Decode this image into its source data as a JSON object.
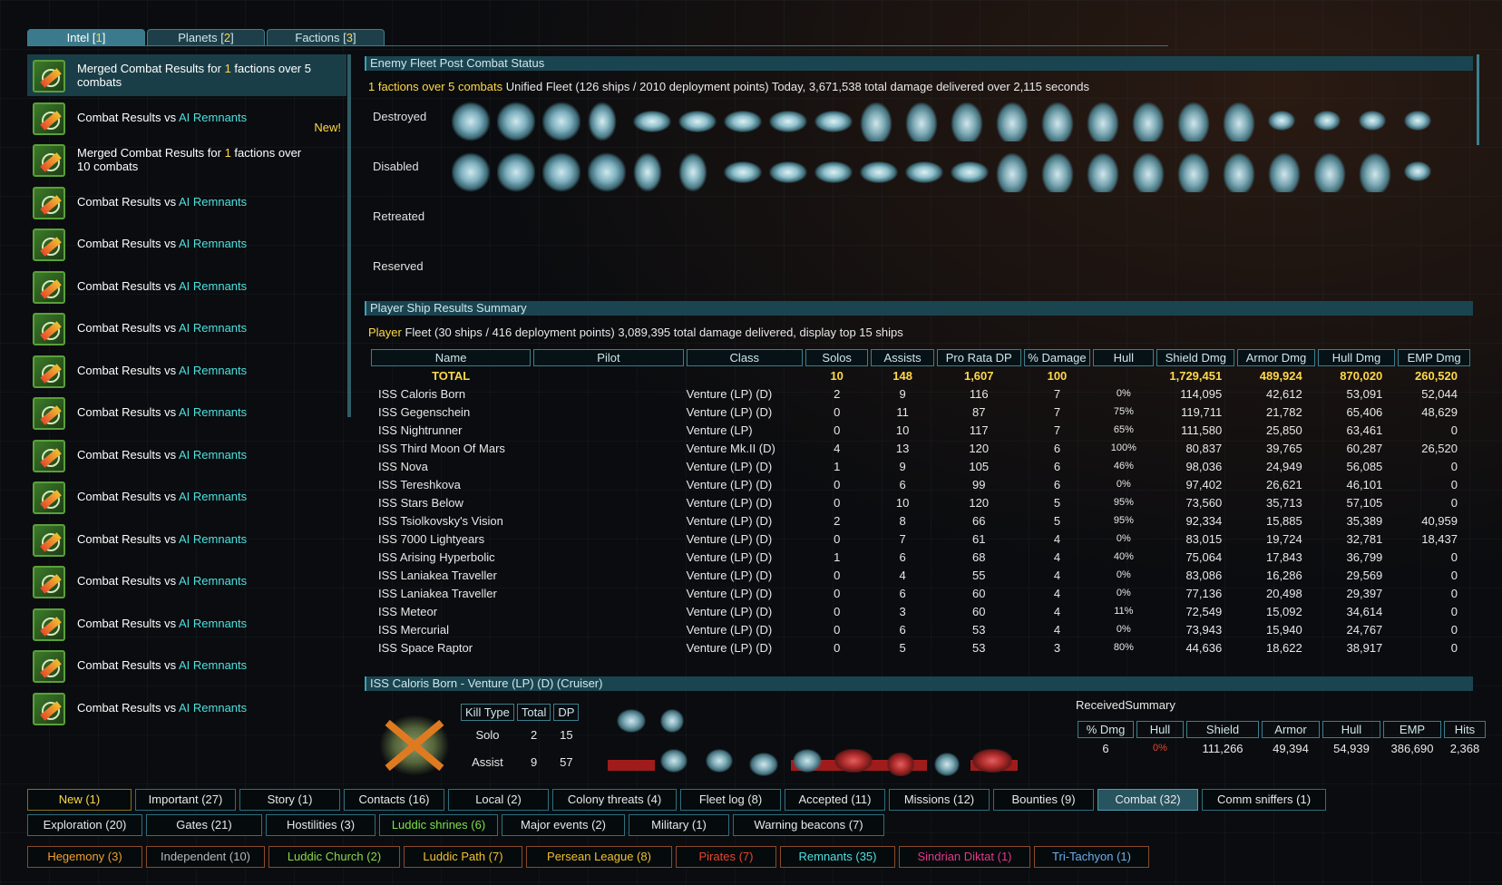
{
  "top_tabs": [
    {
      "label": "Intel",
      "count": "1"
    },
    {
      "label": "Planets",
      "count": "2"
    },
    {
      "label": "Factions",
      "count": "3"
    }
  ],
  "intel_list": {
    "items": [
      {
        "pre": "Merged Combat Results for ",
        "hl": "1",
        "post": " factions over 5 combats",
        "selected": true
      },
      {
        "pre": "Combat Results vs ",
        "hl": "AI Remnants",
        "new": "New!"
      },
      {
        "pre": "Merged Combat Results for ",
        "hl": "1",
        "post": " factions over 10 combats"
      },
      {
        "pre": "Combat Results vs ",
        "hl": "AI Remnants"
      },
      {
        "pre": "Combat Results vs ",
        "hl": "AI Remnants"
      },
      {
        "pre": "Combat Results vs ",
        "hl": "AI Remnants"
      },
      {
        "pre": "Combat Results vs ",
        "hl": "AI Remnants"
      },
      {
        "pre": "Combat Results vs ",
        "hl": "AI Remnants"
      },
      {
        "pre": "Combat Results vs ",
        "hl": "AI Remnants"
      },
      {
        "pre": "Combat Results vs ",
        "hl": "AI Remnants"
      },
      {
        "pre": "Combat Results vs ",
        "hl": "AI Remnants"
      },
      {
        "pre": "Combat Results vs ",
        "hl": "AI Remnants"
      },
      {
        "pre": "Combat Results vs ",
        "hl": "AI Remnants"
      },
      {
        "pre": "Combat Results vs ",
        "hl": "AI Remnants"
      },
      {
        "pre": "Combat Results vs ",
        "hl": "AI Remnants"
      },
      {
        "pre": "Combat Results vs ",
        "hl": "AI Remnants"
      }
    ]
  },
  "enemy": {
    "title": "Enemy Fleet Post Combat Status",
    "summary_hl": "1 factions over 5 combats",
    "summary_rest": " Unified Fleet (126 ships / 2010 deployment points) Today, 3,671,538 total damage delivered over 2,115 seconds",
    "rows": {
      "destroyed": "Destroyed",
      "disabled": "Disabled",
      "retreated": "Retreated",
      "reserved": "Reserved"
    }
  },
  "player": {
    "title": "Player Ship Results Summary",
    "summary_hl": "Player",
    "summary_rest": " Fleet (30 ships / 416 deployment points) 3,089,395 total damage delivered, display top 15 ships",
    "headers": [
      "Name",
      "Pilot",
      "Class",
      "Solos",
      "Assists",
      "Pro Rata DP",
      "% Damage",
      "Hull",
      "Shield Dmg",
      "Armor Dmg",
      "Hull Dmg",
      "EMP Dmg"
    ],
    "total": {
      "name": "TOTAL",
      "solos": "10",
      "assists": "148",
      "dp": "1,607",
      "dmg": "100",
      "shield": "1,729,451",
      "armor": "489,924",
      "hull_dmg": "870,020",
      "emp": "260,520"
    },
    "ships": [
      {
        "name": "ISS Caloris Born",
        "class": "Venture (LP) (D)",
        "solos": "2",
        "assists": "9",
        "dp": "116",
        "dmg": "7",
        "hull": "0%",
        "hc": "red",
        "shield": "114,095",
        "armor": "42,612",
        "hull_dmg": "53,091",
        "emp": "52,044"
      },
      {
        "name": "ISS Gegenschein",
        "class": "Venture (LP) (D)",
        "solos": "0",
        "assists": "11",
        "dp": "87",
        "dmg": "7",
        "hull": "75%",
        "hc": "yellow",
        "shield": "119,711",
        "armor": "21,782",
        "hull_dmg": "65,406",
        "emp": "48,629"
      },
      {
        "name": "ISS Nightrunner",
        "class": "Venture (LP)",
        "solos": "0",
        "assists": "10",
        "dp": "117",
        "dmg": "7",
        "hull": "65%",
        "hc": "yellow",
        "shield": "111,580",
        "armor": "25,850",
        "hull_dmg": "63,461",
        "emp": "0"
      },
      {
        "name": "ISS Third Moon Of Mars",
        "class": "Venture Mk.II (D)",
        "solos": "4",
        "assists": "13",
        "dp": "120",
        "dmg": "6",
        "hull": "100%",
        "hc": "white",
        "shield": "80,837",
        "armor": "39,765",
        "hull_dmg": "60,287",
        "emp": "26,520"
      },
      {
        "name": "ISS Nova",
        "class": "Venture (LP) (D)",
        "solos": "1",
        "assists": "9",
        "dp": "105",
        "dmg": "6",
        "hull": "46%",
        "hc": "orange",
        "shield": "98,036",
        "armor": "24,949",
        "hull_dmg": "56,085",
        "emp": "0"
      },
      {
        "name": "ISS Tereshkova",
        "class": "Venture (LP) (D)",
        "solos": "0",
        "assists": "6",
        "dp": "99",
        "dmg": "6",
        "hull": "0%",
        "hc": "red",
        "shield": "97,402",
        "armor": "26,621",
        "hull_dmg": "46,101",
        "emp": "0"
      },
      {
        "name": "ISS Stars Below",
        "class": "Venture (LP) (D)",
        "solos": "0",
        "assists": "10",
        "dp": "120",
        "dmg": "5",
        "hull": "95%",
        "hc": "yellow",
        "shield": "73,560",
        "armor": "35,713",
        "hull_dmg": "57,105",
        "emp": "0"
      },
      {
        "name": "ISS Tsiolkovsky's Vision",
        "class": "Venture (LP) (D)",
        "solos": "2",
        "assists": "8",
        "dp": "66",
        "dmg": "5",
        "hull": "95%",
        "hc": "yellow",
        "shield": "92,334",
        "armor": "15,885",
        "hull_dmg": "35,389",
        "emp": "40,959"
      },
      {
        "name": "ISS 7000 Lightyears",
        "class": "Venture (LP) (D)",
        "solos": "0",
        "assists": "7",
        "dp": "61",
        "dmg": "4",
        "hull": "0%",
        "hc": "red",
        "shield": "83,015",
        "armor": "19,724",
        "hull_dmg": "32,781",
        "emp": "18,437"
      },
      {
        "name": "ISS Arising Hyperbolic",
        "class": "Venture (LP) (D)",
        "solos": "1",
        "assists": "6",
        "dp": "68",
        "dmg": "4",
        "hull": "40%",
        "hc": "orange",
        "shield": "75,064",
        "armor": "17,843",
        "hull_dmg": "36,799",
        "emp": "0"
      },
      {
        "name": "ISS Laniakea Traveller",
        "class": "Venture (LP) (D)",
        "solos": "0",
        "assists": "4",
        "dp": "55",
        "dmg": "4",
        "hull": "0%",
        "hc": "red",
        "shield": "83,086",
        "armor": "16,286",
        "hull_dmg": "29,569",
        "emp": "0"
      },
      {
        "name": "ISS Laniakea Traveller",
        "class": "Venture (LP) (D)",
        "solos": "0",
        "assists": "6",
        "dp": "60",
        "dmg": "4",
        "hull": "0%",
        "hc": "red",
        "shield": "77,136",
        "armor": "20,498",
        "hull_dmg": "29,397",
        "emp": "0"
      },
      {
        "name": "ISS Meteor",
        "class": "Venture (LP) (D)",
        "solos": "0",
        "assists": "3",
        "dp": "60",
        "dmg": "4",
        "hull": "11%",
        "hc": "red",
        "shield": "72,549",
        "armor": "15,092",
        "hull_dmg": "34,614",
        "emp": "0"
      },
      {
        "name": "ISS Mercurial",
        "class": "Venture (LP) (D)",
        "solos": "0",
        "assists": "6",
        "dp": "53",
        "dmg": "4",
        "hull": "0%",
        "hc": "red",
        "shield": "73,943",
        "armor": "15,940",
        "hull_dmg": "24,767",
        "emp": "0"
      },
      {
        "name": "ISS Space Raptor",
        "class": "Venture (LP) (D)",
        "solos": "0",
        "assists": "5",
        "dp": "53",
        "dmg": "3",
        "hull": "80%",
        "hc": "yellow",
        "shield": "44,636",
        "armor": "18,622",
        "hull_dmg": "38,917",
        "emp": "0"
      }
    ]
  },
  "detail": {
    "title": "ISS Caloris Born - Venture (LP) (D) (Cruiser)",
    "kill_headers": [
      "Kill Type",
      "Total",
      "DP"
    ],
    "kills": [
      {
        "type": "Solo",
        "total": "2",
        "dp": "15"
      },
      {
        "type": "Assist",
        "total": "9",
        "dp": "57"
      }
    ],
    "received_title": "ReceivedSummary",
    "recv_headers": [
      "% Dmg",
      "Hull",
      "Shield",
      "Armor",
      "Hull",
      "EMP",
      "Hits"
    ],
    "recv_values": {
      "dmg": "6",
      "hull": "0%",
      "shield": "111,266",
      "armor": "49,394",
      "hull_dmg": "54,939",
      "emp": "386,690",
      "hits": "2,368"
    }
  },
  "filters_row1": [
    "New (1)",
    "Important (27)",
    "Story (1)",
    "Contacts (16)",
    "Local (2)",
    "Colony threats (4)",
    "Fleet log (8)",
    "Accepted (11)",
    "Missions (12)",
    "Bounties (9)",
    "Combat (32)",
    "Comm sniffers (1)"
  ],
  "filters_row2": [
    "Exploration (20)",
    "Gates (21)",
    "Hostilities (3)",
    "Luddic shrines (6)",
    "Major events (2)",
    "Military (1)",
    "Warning beacons (7)"
  ],
  "factions": [
    {
      "label": "Hegemony (3)",
      "color": "#f0a030"
    },
    {
      "label": "Independent (10)",
      "color": "#b8b8b8"
    },
    {
      "label": "Luddic Church (2)",
      "color": "#8ad84a"
    },
    {
      "label": "Luddic Path (7)",
      "color": "#f0c030"
    },
    {
      "label": "Persean League (8)",
      "color": "#f0c030"
    },
    {
      "label": "Pirates (7)",
      "color": "#e8452e"
    },
    {
      "label": "Remnants (35)",
      "color": "#4fe0e0"
    },
    {
      "label": "Sindrian Diktat (1)",
      "color": "#e03a8a"
    },
    {
      "label": "Tri-Tachyon (1)",
      "color": "#6ab0f0"
    }
  ]
}
